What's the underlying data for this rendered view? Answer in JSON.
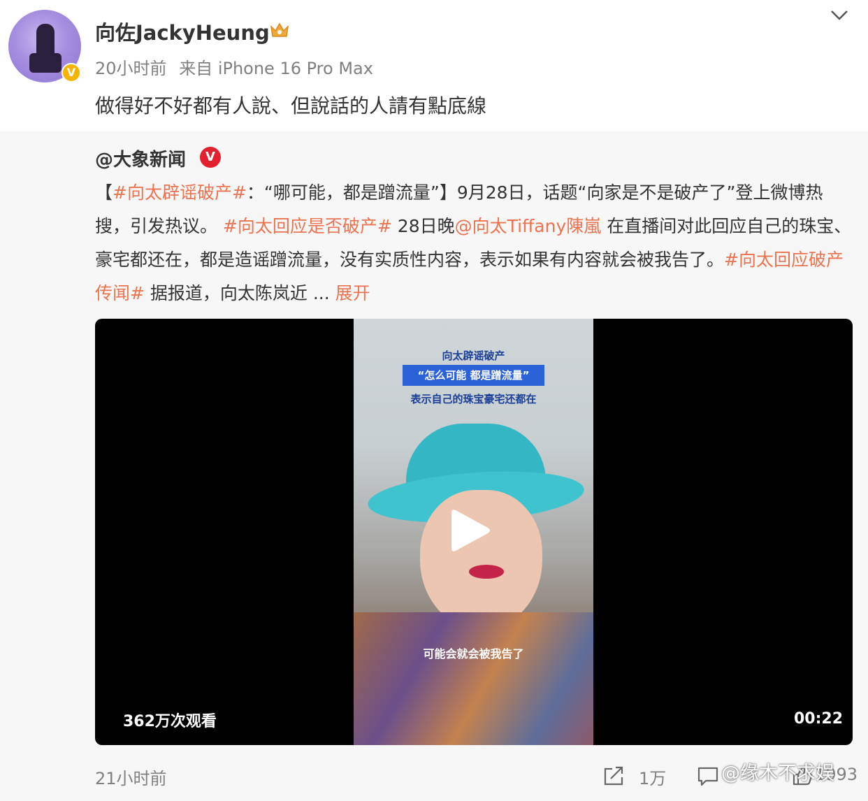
{
  "post": {
    "username": "向佐JackyHeung",
    "time": "20小时前",
    "source": "来自 iPhone 16 Pro Max",
    "text": "做得好不好都有人說、但說話的人請有點底線"
  },
  "repost": {
    "source_name": "@大象新闻",
    "verified_mark": "V",
    "body": {
      "open_bracket": "【",
      "tag1": "#向太辟谣破产#",
      "text1": "：“哪可能，都是蹭流量”】9月28日，话题“向家是不是破产了”登上微博热搜，引发热议。 ",
      "tag2": "#向太回应是否破产#",
      "text2": " 28日晚",
      "mention": "@向太Tiffany陳嵐",
      "text3": " 在直播间对此回应自己的珠宝、豪宅都还在，都是造谣蹭流量，没有实质性内容，表示如果有内容就会被我告了。",
      "tag3": "#向太回应破产传闻#",
      "text4": " 据报道，向太陈岚近 ... ",
      "expand": "展开"
    },
    "video": {
      "caption_title": "向太辟谣破产",
      "caption_quote": "“怎么可能 都是蹭流量”",
      "caption_sub": "表示自己的珠宝豪宅还都在",
      "subtitle": "可能会就会被我告了",
      "views": "362万次观看",
      "duration": "00:22"
    }
  },
  "footer": {
    "time": "21小时前",
    "share_count": "1万",
    "like_count": "1993",
    "watermark": "@缘木不求娱"
  },
  "icons": {
    "verified_badge": "gold-v-badge-icon",
    "crown": "crown-icon",
    "chevron": "chevron-down-icon",
    "play": "play-icon",
    "share": "share-icon",
    "comment": "comment-icon",
    "like": "like-icon"
  },
  "colors": {
    "accent": "#eb7350",
    "muted": "#808080",
    "text": "#333333",
    "verified_red": "#e5202e",
    "verified_gold": "#f5b400"
  }
}
